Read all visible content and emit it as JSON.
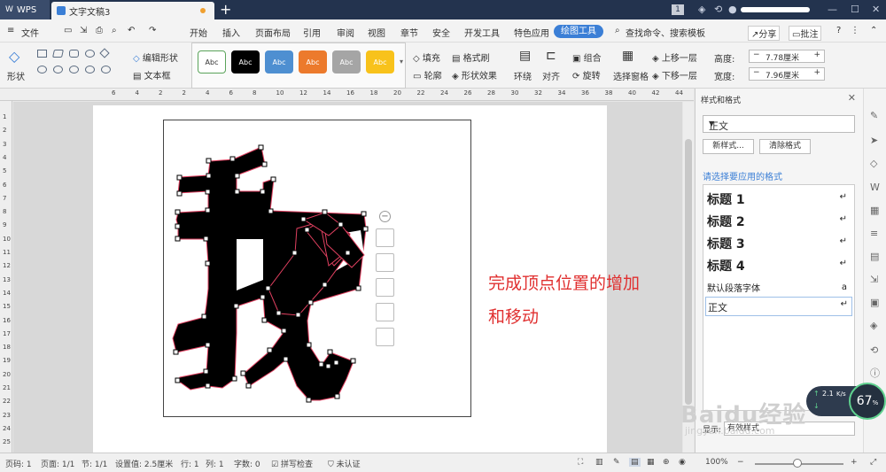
{
  "titlebar": {
    "app_label": "WPS",
    "doc_tab": "文字文稿3",
    "new_tab": "+",
    "page_badge": "1"
  },
  "menubar": {
    "file": "文件",
    "items": [
      "开始",
      "插入",
      "页面布局",
      "引用",
      "审阅",
      "视图",
      "章节",
      "安全",
      "开发工具",
      "特色应用"
    ],
    "active": "绘图工具",
    "search": "查找命令、搜索模板",
    "share": "分享",
    "comment": "批注"
  },
  "ribbon": {
    "shape_label": "形状",
    "edit_shape": "编辑形状",
    "text_box": "文本框",
    "styles": [
      {
        "label": "Abc",
        "bg": "#ffffff",
        "fg": "#333333",
        "border": "#5aa35a"
      },
      {
        "label": "Abc",
        "bg": "#000000",
        "fg": "#ffffff",
        "border": "#000000"
      },
      {
        "label": "Abc",
        "bg": "#4e8fd1",
        "fg": "#ffffff",
        "border": "#4e8fd1"
      },
      {
        "label": "Abc",
        "bg": "#ec7a2c",
        "fg": "#ffffff",
        "border": "#ec7a2c"
      },
      {
        "label": "Abc",
        "bg": "#a5a5a5",
        "fg": "#ffffff",
        "border": "#a5a5a5"
      },
      {
        "label": "Abc",
        "bg": "#f8c21b",
        "fg": "#ffffff",
        "border": "#f8c21b"
      }
    ],
    "fill": "填充",
    "format_painter": "格式刷",
    "outline": "轮廓",
    "shape_effect": "形状效果",
    "wrap": "环绕",
    "align": "对齐",
    "group": "组合",
    "rotate": "旋转",
    "selection_pane": "选择窗格",
    "bring_forward": "上移一层",
    "send_backward": "下移一层",
    "height_label": "高度:",
    "height_value": "7.78厘米",
    "width_label": "宽度:",
    "width_value": "7.96厘米"
  },
  "ruler": {
    "h_numbers": [
      "6",
      "4",
      "2",
      "2",
      "4",
      "6",
      "8",
      "10",
      "12",
      "14",
      "16",
      "18",
      "20",
      "22",
      "24",
      "26",
      "28",
      "30",
      "32",
      "34",
      "36",
      "38",
      "40",
      "42",
      "44"
    ],
    "v_numbers": [
      "1",
      "2",
      "3",
      "4",
      "5",
      "6",
      "7",
      "8",
      "9",
      "10",
      "11",
      "12",
      "13",
      "14",
      "15",
      "16",
      "17",
      "18",
      "19",
      "20",
      "21",
      "22",
      "23",
      "24",
      "25"
    ]
  },
  "document": {
    "note_line1": "完成顶点位置的增加",
    "note_line2": "和移动"
  },
  "panel": {
    "title": "样式和格式",
    "current_style": "正文",
    "new_style": "新样式...",
    "clear_format": "清除格式",
    "apply_label": "请选择要应用的格式",
    "styles": [
      "标题 1",
      "标题 2",
      "标题 3",
      "标题 4"
    ],
    "default_font": "默认段落字体",
    "body": "正文",
    "display_label": "显示:",
    "display_value": "有效样式"
  },
  "speed": {
    "rate": "2.1",
    "unit": "K/s",
    "percent": "67"
  },
  "watermark": {
    "logo": "Baidu经验",
    "url": "jingyan.baidu.com"
  },
  "statusbar": {
    "page_num": "页码: 1",
    "pages": "页面: 1/1",
    "section": "节: 1/1",
    "setting": "设置值: 2.5厘米",
    "row": "行: 1",
    "col": "列: 1",
    "words": "字数: 0",
    "spell": "拼写检查",
    "auth": "未认证",
    "zoom": "100%",
    "zoom_level": 100
  }
}
